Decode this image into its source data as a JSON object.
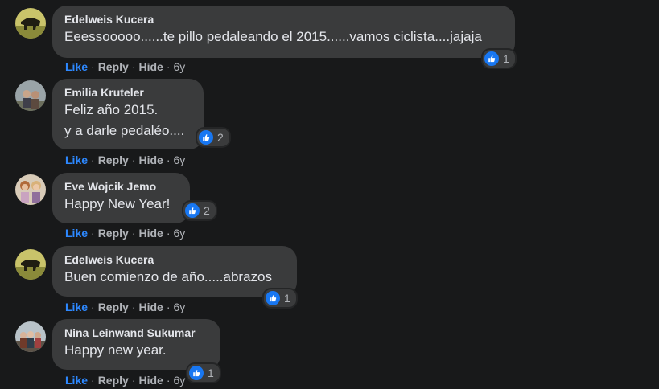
{
  "actions": {
    "like": "Like",
    "reply": "Reply",
    "hide": "Hide",
    "separator": "·"
  },
  "colors": {
    "background": "#18191a",
    "bubble": "#3a3b3c",
    "like_blue": "#2d88ff",
    "badge_blue": "#1877f2"
  },
  "comments": [
    {
      "author": "Edelweis Kucera",
      "lines": [
        "Eeessooooo......te pillo pedaleando el 2015......vamos ciclista....jajaja"
      ],
      "reaction_icon": "thumbs-up-icon",
      "reaction_count": "1",
      "time": "6y"
    },
    {
      "author": "Emilia Kruteler",
      "lines": [
        "Feliz año 2015.",
        "y a darle pedaléo...."
      ],
      "reaction_icon": "thumbs-up-icon",
      "reaction_count": "2",
      "time": "6y"
    },
    {
      "author": "Eve Wojcik Jemo",
      "lines": [
        "Happy New Year!"
      ],
      "reaction_icon": "thumbs-up-icon",
      "reaction_count": "2",
      "time": "6y"
    },
    {
      "author": "Edelweis Kucera",
      "lines": [
        "Buen comienzo de año.....abrazos"
      ],
      "reaction_icon": "thumbs-up-icon",
      "reaction_count": "1",
      "time": "6y"
    },
    {
      "author": "Nina Leinwand Sukumar",
      "lines": [
        "Happy new year."
      ],
      "reaction_icon": "thumbs-up-icon",
      "reaction_count": "1",
      "time": "6y"
    }
  ]
}
